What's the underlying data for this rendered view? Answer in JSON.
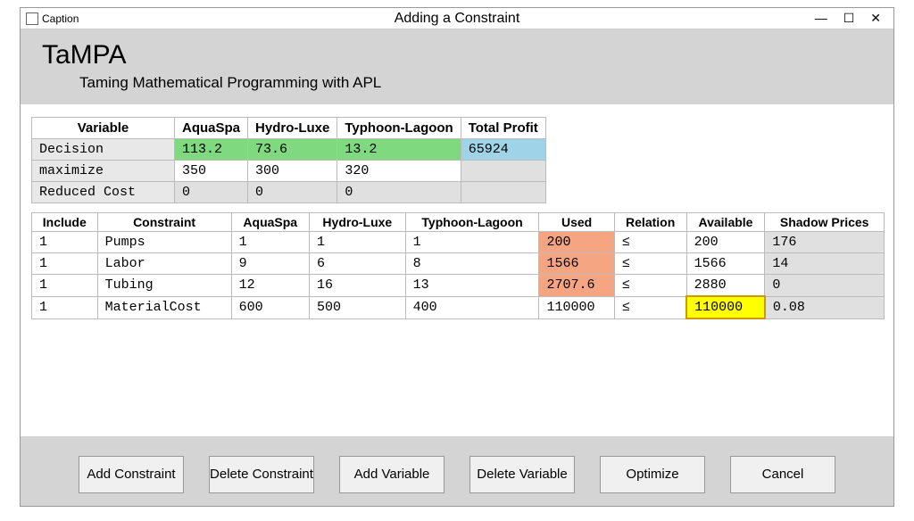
{
  "titlebar": {
    "caption": "Caption",
    "center": "Adding a Constraint"
  },
  "header": {
    "title": "TaMPA",
    "subtitle": "Taming Mathematical Programming with APL"
  },
  "var_table": {
    "headers": [
      "Variable",
      "AquaSpa",
      "Hydro-Luxe",
      "Typhoon-Lagoon",
      "Total Profit"
    ],
    "rows": [
      {
        "label": "Decision",
        "cells": [
          "113.2",
          "73.6",
          "13.2",
          "65924"
        ],
        "styles": [
          "green",
          "green",
          "green",
          "blue"
        ]
      },
      {
        "label": "maximize",
        "cells": [
          "350",
          "300",
          "320",
          ""
        ],
        "styles": [
          "",
          "",
          "",
          "grey"
        ]
      },
      {
        "label": "Reduced Cost",
        "cells": [
          "0",
          "0",
          "0",
          ""
        ],
        "styles": [
          "grey",
          "grey",
          "grey",
          "grey"
        ]
      }
    ]
  },
  "con_table": {
    "headers": [
      "Include",
      "Constraint",
      "AquaSpa",
      "Hydro-Luxe",
      "Typhoon-Lagoon",
      "Used",
      "Relation",
      "Available",
      "Shadow Prices"
    ],
    "rows": [
      {
        "cells": [
          "1",
          "Pumps",
          "1",
          "1",
          "1",
          "200",
          "≤",
          "200",
          "176"
        ],
        "styles": [
          "",
          "",
          "",
          "",
          "",
          "orange",
          "",
          "",
          "grey"
        ]
      },
      {
        "cells": [
          "1",
          "Labor",
          "9",
          "6",
          "8",
          "1566",
          "≤",
          "1566",
          "14"
        ],
        "styles": [
          "",
          "",
          "",
          "",
          "",
          "orange",
          "",
          "",
          "grey"
        ]
      },
      {
        "cells": [
          "1",
          "Tubing",
          "12",
          "16",
          "13",
          "2707.6",
          "≤",
          "2880",
          "0"
        ],
        "styles": [
          "",
          "",
          "",
          "",
          "",
          "orange",
          "",
          "",
          "grey"
        ]
      },
      {
        "cells": [
          "1",
          "MaterialCost",
          "600",
          "500",
          "400",
          "110000",
          "≤",
          "110000",
          "0.08"
        ],
        "styles": [
          "",
          "",
          "",
          "",
          "",
          "",
          "",
          "yellow",
          "grey"
        ]
      }
    ]
  },
  "buttons": {
    "add_constraint": "Add Constraint",
    "delete_constraint": "Delete Constraint",
    "add_variable": "Add Variable",
    "delete_variable": "Delete Variable",
    "optimize": "Optimize",
    "cancel": "Cancel"
  }
}
